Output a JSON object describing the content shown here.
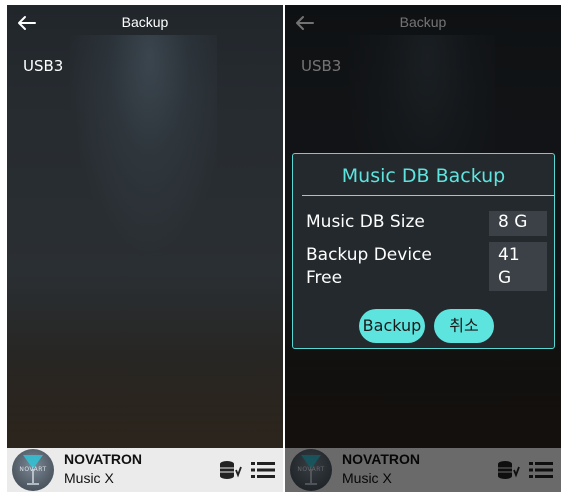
{
  "left_screen": {
    "header": {
      "title": "Backup",
      "back_icon": "arrow-left-icon"
    },
    "device_list": [
      "USB3"
    ],
    "bottom_bar": {
      "logo_text": "NOVART",
      "brand": "NOVATRON",
      "app_name": "Music X",
      "icons": [
        "database-icon",
        "list-icon"
      ]
    }
  },
  "right_screen": {
    "header": {
      "title": "Backup",
      "back_icon": "arrow-left-icon"
    },
    "device_list": [
      "USB3"
    ],
    "dialog": {
      "title": "Music DB Backup",
      "rows": [
        {
          "label": "Music DB Size",
          "value": "8 G"
        },
        {
          "label_line1": "Backup Device",
          "label_line2": "Free",
          "value_line1": "41",
          "value_line2": "G"
        }
      ],
      "buttons": {
        "confirm": "Backup",
        "cancel": "취소"
      }
    },
    "bottom_bar": {
      "logo_text": "NOVART",
      "brand": "NOVATRON",
      "app_name": "Music X",
      "icons": [
        "database-icon",
        "list-icon"
      ]
    }
  },
  "colors": {
    "accent": "#5ee4df",
    "dialog_bg": "#23292d",
    "value_box_bg": "#3b4146",
    "bottom_bar_bg": "#ebebeb"
  }
}
